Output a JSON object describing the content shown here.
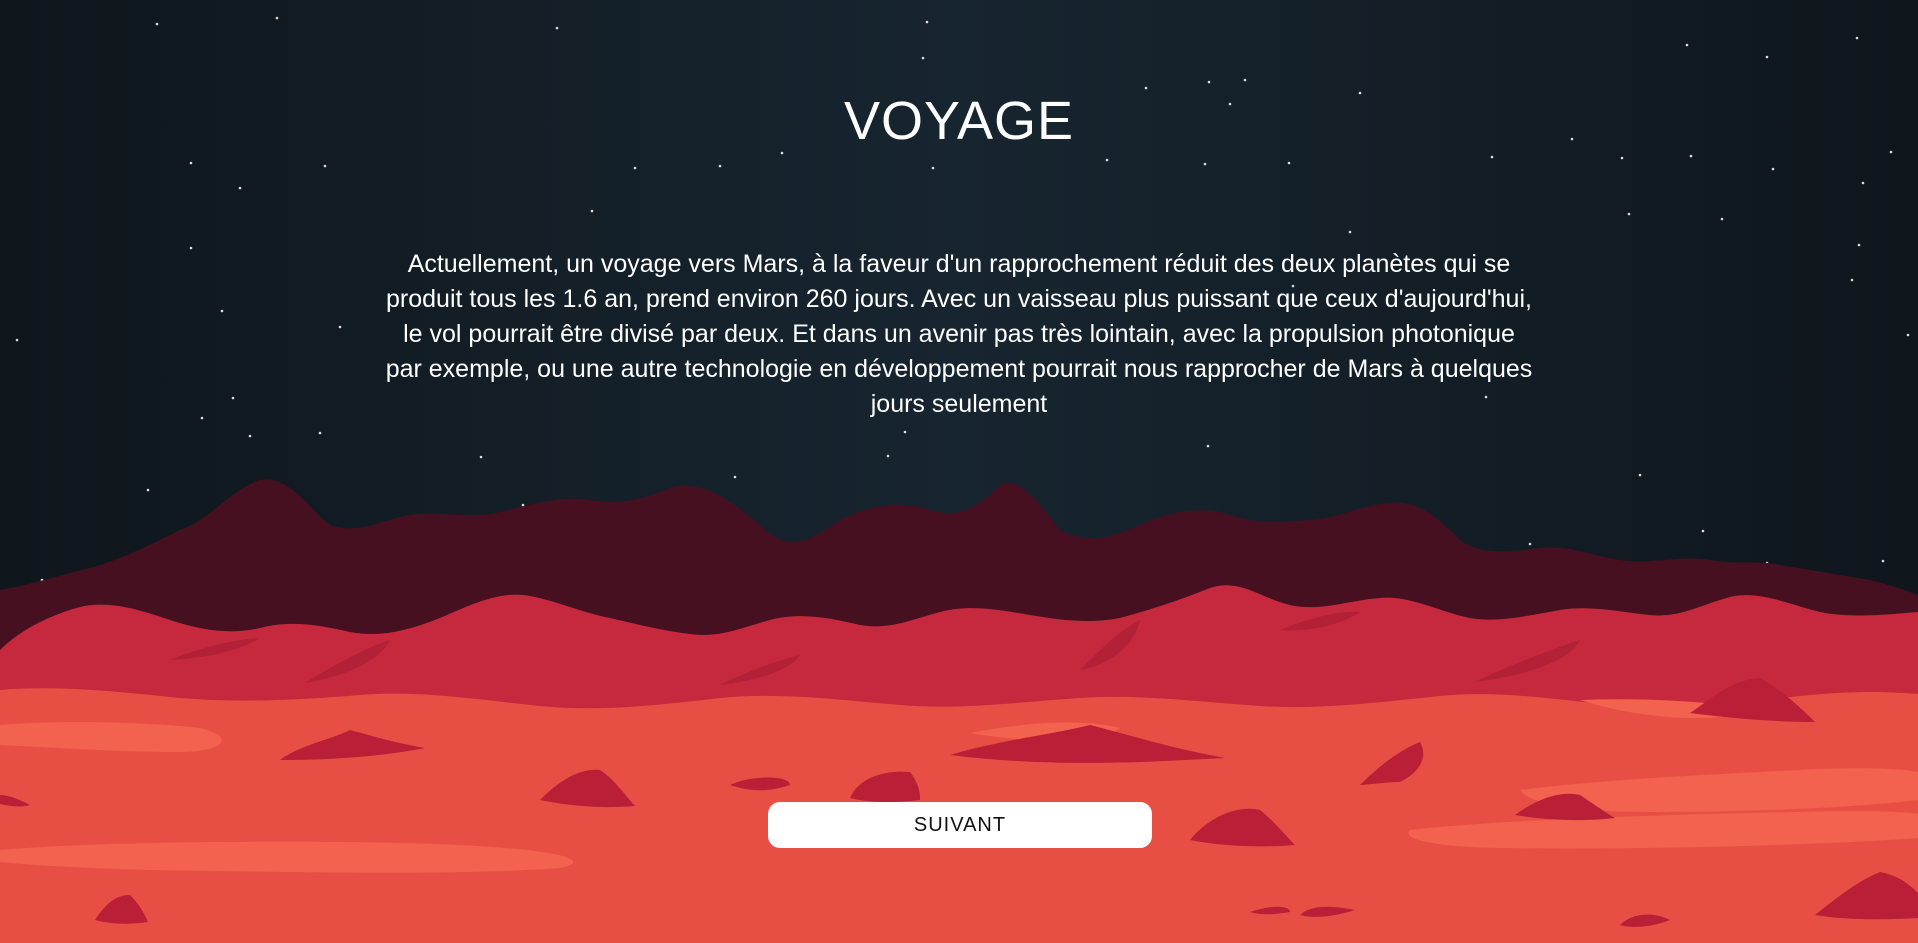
{
  "page": {
    "title": "VOYAGE",
    "paragraph": "Actuellement, un voyage vers Mars, à la faveur d'un rapprochement réduit des deux planètes qui se produit tous les 1.6 an, prend environ 260 jours. Avec un vaisseau plus puissant que ceux d'aujourd'hui, le vol pourrait être divisé par deux. Et dans un avenir pas très lointain, avec la propulsion photonique par exemple, ou une autre technologie en développement pourrait nous rapprocher de Mars à quelques jours seulement",
    "next_button_label": "SUIVANT"
  },
  "colors": {
    "sky": "#141d24",
    "far_mountains": "#461021",
    "mid_hills": "#c6283d",
    "ground": "#e84f44",
    "ground_highlight": "#f2624f",
    "rocks": "#b91f37",
    "text": "#ffffff",
    "button_bg": "#ffffff",
    "button_text": "#111111"
  }
}
